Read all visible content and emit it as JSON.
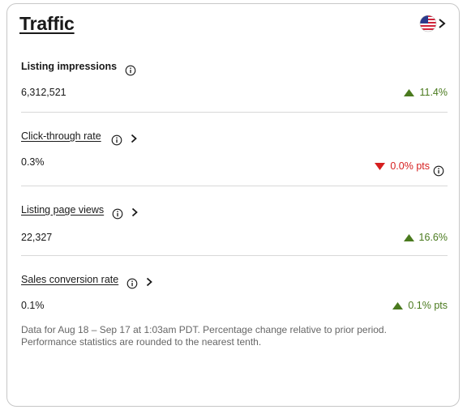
{
  "card": {
    "title": "Traffic",
    "flag_icon": "us-flag-icon",
    "nav_icon": "chevron-right-icon"
  },
  "metrics": [
    {
      "label": "Listing impressions",
      "value": "6,312,521",
      "change": "11.4%",
      "direction": "up"
    },
    {
      "label": "Click-through rate",
      "value": "0.3%",
      "change": "0.0% pts",
      "direction": "down"
    },
    {
      "label": "Listing page views",
      "value": "22,327",
      "change": "16.6%",
      "direction": "up"
    },
    {
      "label": "Sales conversion rate",
      "value": "0.1%",
      "change": "0.1% pts",
      "direction": "up"
    }
  ],
  "footnote": {
    "line1": "Data for Aug 18 – Sep 17 at 1:03am PDT. Percentage change relative to prior period.",
    "line2": "Performance statistics are rounded to the nearest tenth."
  },
  "colors": {
    "up": "#4a7a1e",
    "down": "#d61f1f",
    "border": "#c7c7c7"
  }
}
